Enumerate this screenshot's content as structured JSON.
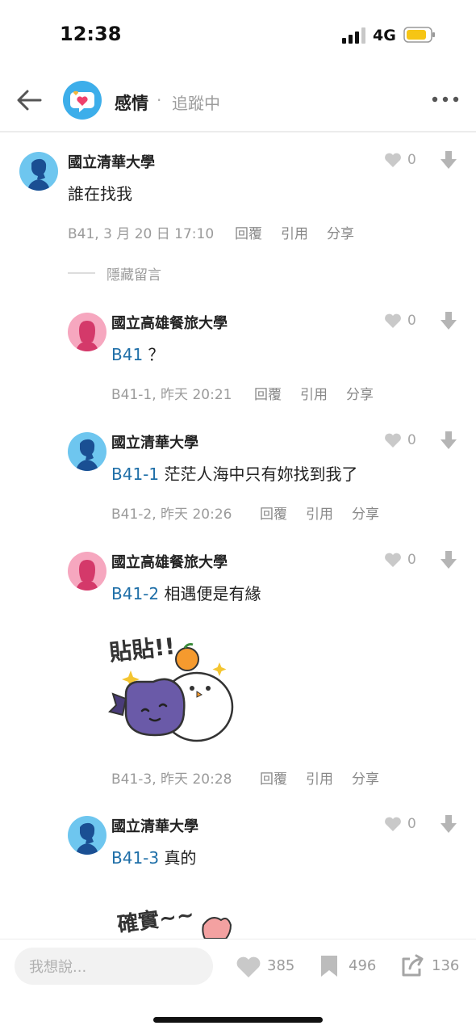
{
  "status_bar": {
    "time": "12:38",
    "network": "4G"
  },
  "header": {
    "board_name": "感情",
    "separator": "·",
    "follow_label": "追蹤中"
  },
  "comments": [
    {
      "author": "國立清華大學",
      "text": "誰在找我",
      "meta": "B41, 3 月 20 日 17:10",
      "likes": "0"
    },
    {
      "author": "國立高雄餐旅大學",
      "tag": "B41",
      "text": "？",
      "meta": "B41-1, 昨天 20:21",
      "likes": "0"
    },
    {
      "author": "國立清華大學",
      "tag": "B41-1",
      "text": "茫茫人海中只有妳找到我了",
      "meta": "B41-2, 昨天 20:26",
      "likes": "0"
    },
    {
      "author": "國立高雄餐旅大學",
      "tag": "B41-2",
      "text": "相遇便是有緣",
      "meta": "B41-3, 昨天 20:28",
      "likes": "0",
      "sticker_text": "貼貼!!"
    },
    {
      "author": "國立清華大學",
      "tag": "B41-3",
      "text": "真的",
      "likes": "0",
      "sticker_text": "確實~~"
    }
  ],
  "actions": {
    "reply": "回覆",
    "quote": "引用",
    "share": "分享"
  },
  "hidden_label": "隱藏留言",
  "bottom_bar": {
    "input_placeholder": "我想說...",
    "likes": "385",
    "bookmarks": "496",
    "shares": "136"
  },
  "colors": {
    "accent_blue": "#1f6fa8",
    "avatar_blue": "#6ec6ef",
    "avatar_pink": "#f6a7bf"
  }
}
